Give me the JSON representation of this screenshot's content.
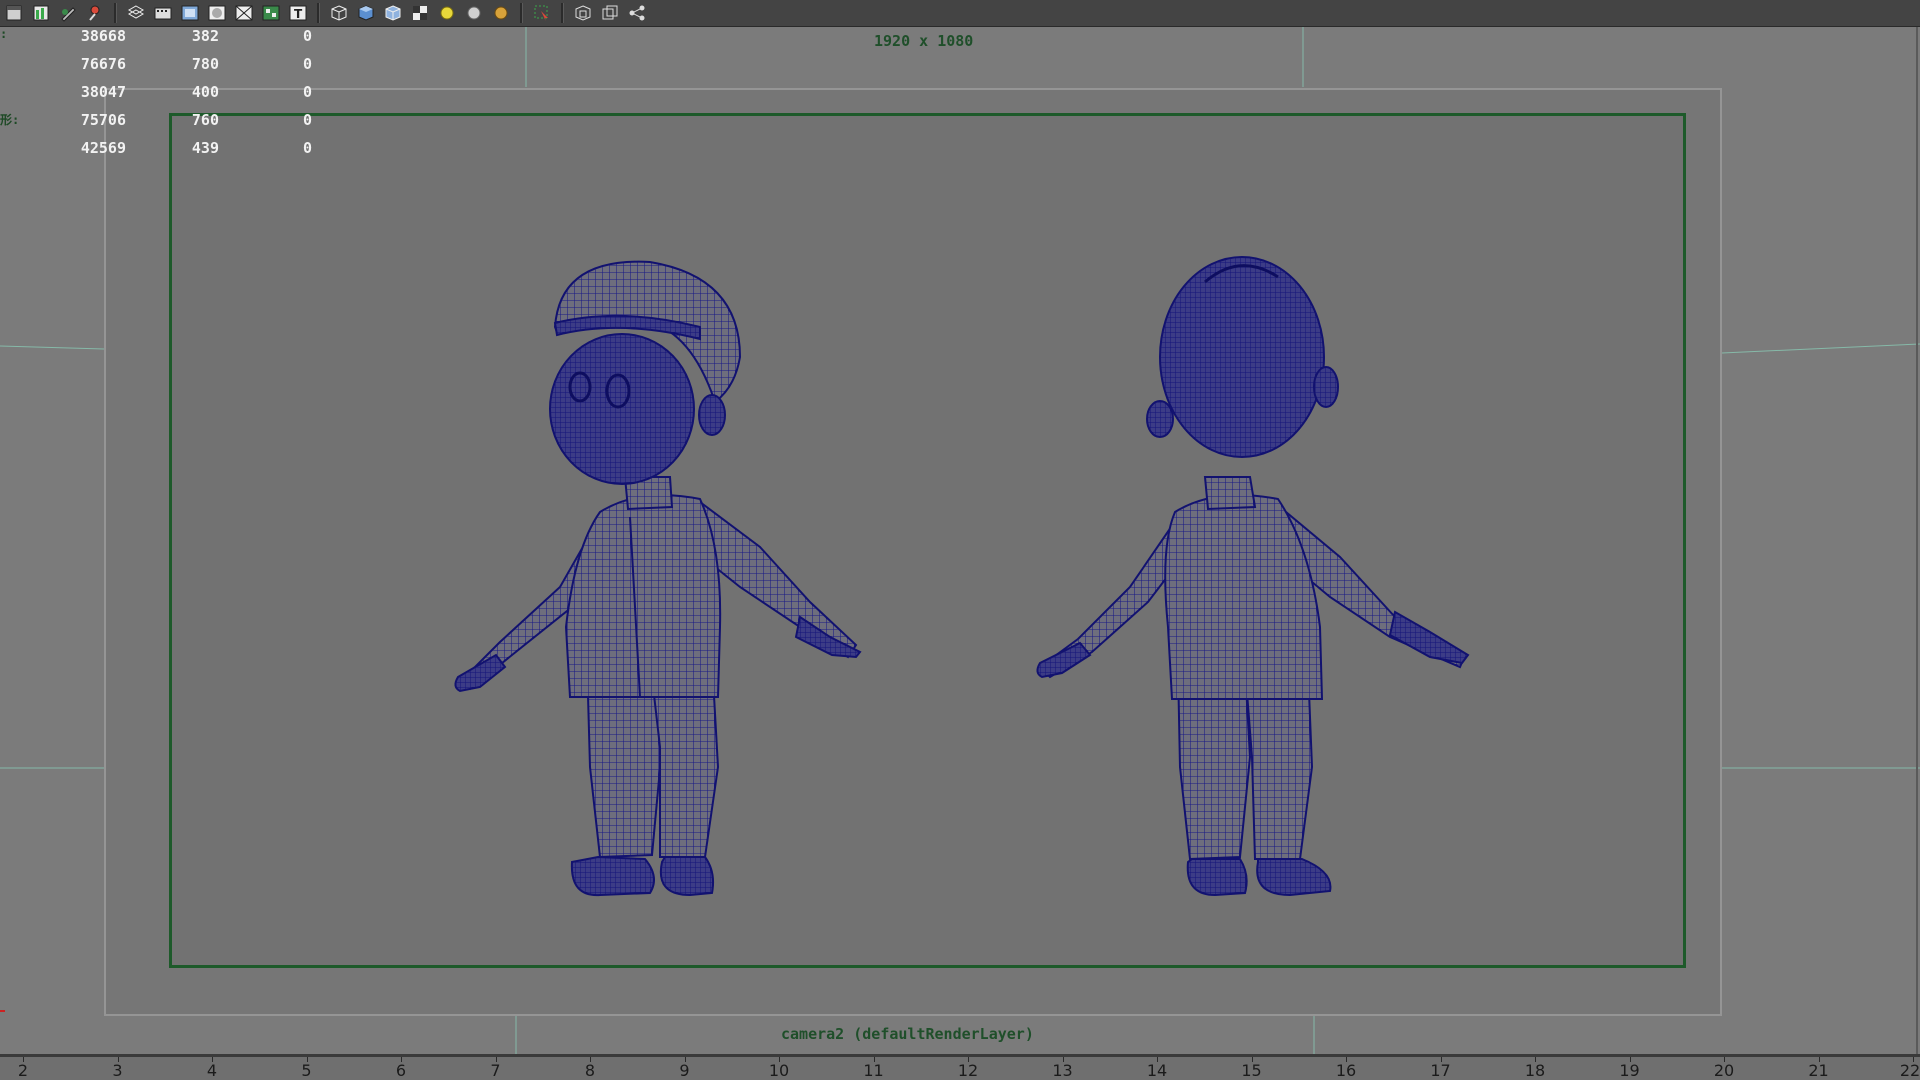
{
  "toolbar": {
    "icons": [
      "panel-icon",
      "graph-icon",
      "wrench-icon",
      "pin-icon",
      "wireframe-icon",
      "film-gate-icon",
      "resolution-gate-icon",
      "gate-mask-icon",
      "field-chart-icon",
      "safe-action-icon",
      "safe-title-icon",
      "wireframe-cube-icon",
      "smooth-shade-cube-icon",
      "shaded-wireframe-cube-icon",
      "textured-icon",
      "default-light-icon",
      "all-lights-icon",
      "shadows-icon",
      "isolate-select-icon",
      "xray-icon",
      "xray-joints-icon",
      "share-icon"
    ]
  },
  "hud": {
    "rows": [
      {
        "label": ":",
        "values": [
          "38668",
          "382",
          "0"
        ]
      },
      {
        "label": "",
        "values": [
          "76676",
          "780",
          "0"
        ]
      },
      {
        "label": "",
        "values": [
          "38047",
          "400",
          "0"
        ]
      },
      {
        "label": "形:",
        "values": [
          "75706",
          "760",
          "0"
        ]
      },
      {
        "label": "",
        "values": [
          "42569",
          "439",
          "0"
        ]
      }
    ]
  },
  "viewport": {
    "resolution_text": "1920 x 1080",
    "camera_text": "camera2 (defaultRenderLayer)",
    "mesh_color": "#1a1a85",
    "gate_color": "#1d5a2a"
  },
  "timeline": {
    "numbers": [
      "2",
      "3",
      "4",
      "5",
      "6",
      "7",
      "8",
      "9",
      "10",
      "11",
      "12",
      "13",
      "14",
      "15",
      "16",
      "17",
      "18",
      "19",
      "20",
      "21",
      "22"
    ]
  }
}
